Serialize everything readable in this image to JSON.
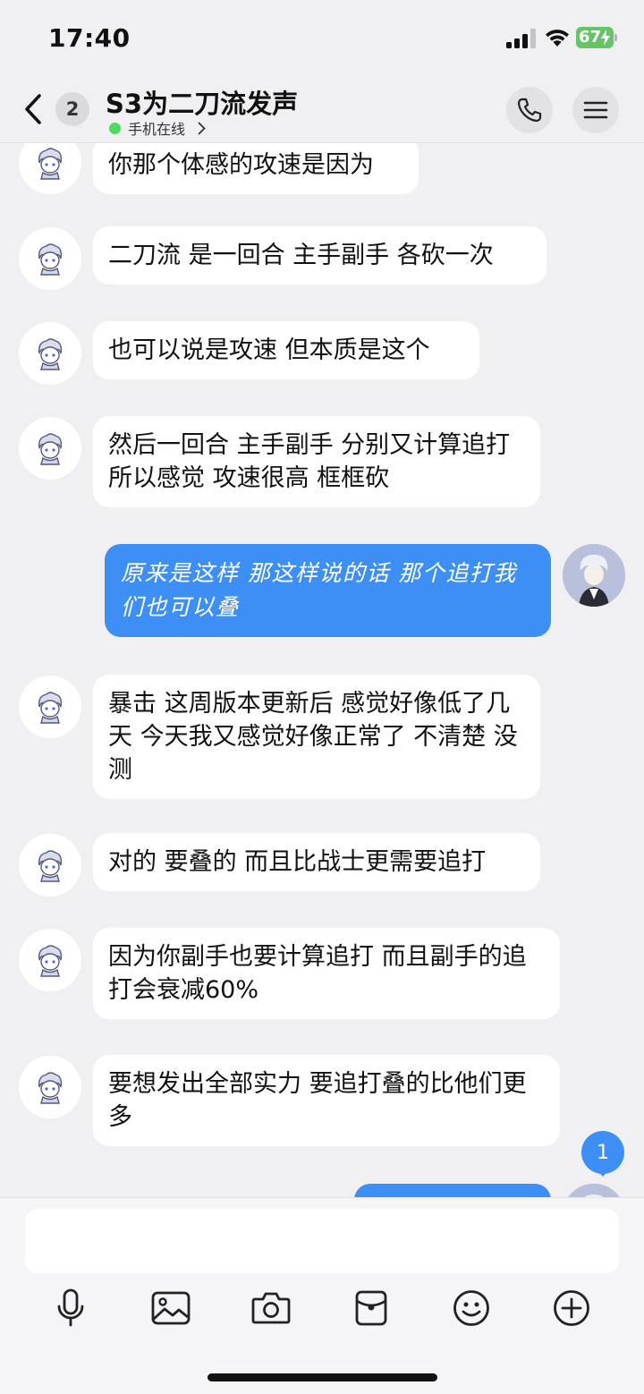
{
  "status_bar": {
    "time": "17:40",
    "battery": "67"
  },
  "header": {
    "unread_count": "2",
    "title": "S3为二刀流发声",
    "online_status": "手机在线"
  },
  "messages": [
    {
      "side": "left",
      "text": "你那个体感的攻速是因为"
    },
    {
      "side": "left",
      "text": "二刀流 是一回合 主手副手 各砍一次"
    },
    {
      "side": "left",
      "text": "也可以说是攻速 但本质是这个"
    },
    {
      "side": "left",
      "text": "然后一回合 主手副手 分别又计算追打 所以感觉 攻速很高 框框砍"
    },
    {
      "side": "right",
      "text": "原来是这样 那这样说的话 那个追打我们也可以叠"
    },
    {
      "side": "left",
      "text": "暴击 这周版本更新后 感觉好像低了几天 今天我又感觉好像正常了 不清楚 没测"
    },
    {
      "side": "left",
      "text": "对的 要叠的 而且比战士更需要追打"
    },
    {
      "side": "left",
      "text": "因为你副手也要计算追打 而且副手的追打会衰减60%"
    },
    {
      "side": "left",
      "text": "要想发出全部实力 要追打叠的比他们更多"
    }
  ],
  "new_message_badge": "1",
  "input": {
    "value": "",
    "placeholder": ""
  },
  "toolbar_icons": [
    "microphone-icon",
    "image-icon",
    "camera-icon",
    "red-packet-icon",
    "emoji-icon",
    "plus-icon"
  ],
  "colors": {
    "accent": "#3d8ff5",
    "online": "#4cd964",
    "battery": "#65c466",
    "background": "#f0f0f2"
  }
}
